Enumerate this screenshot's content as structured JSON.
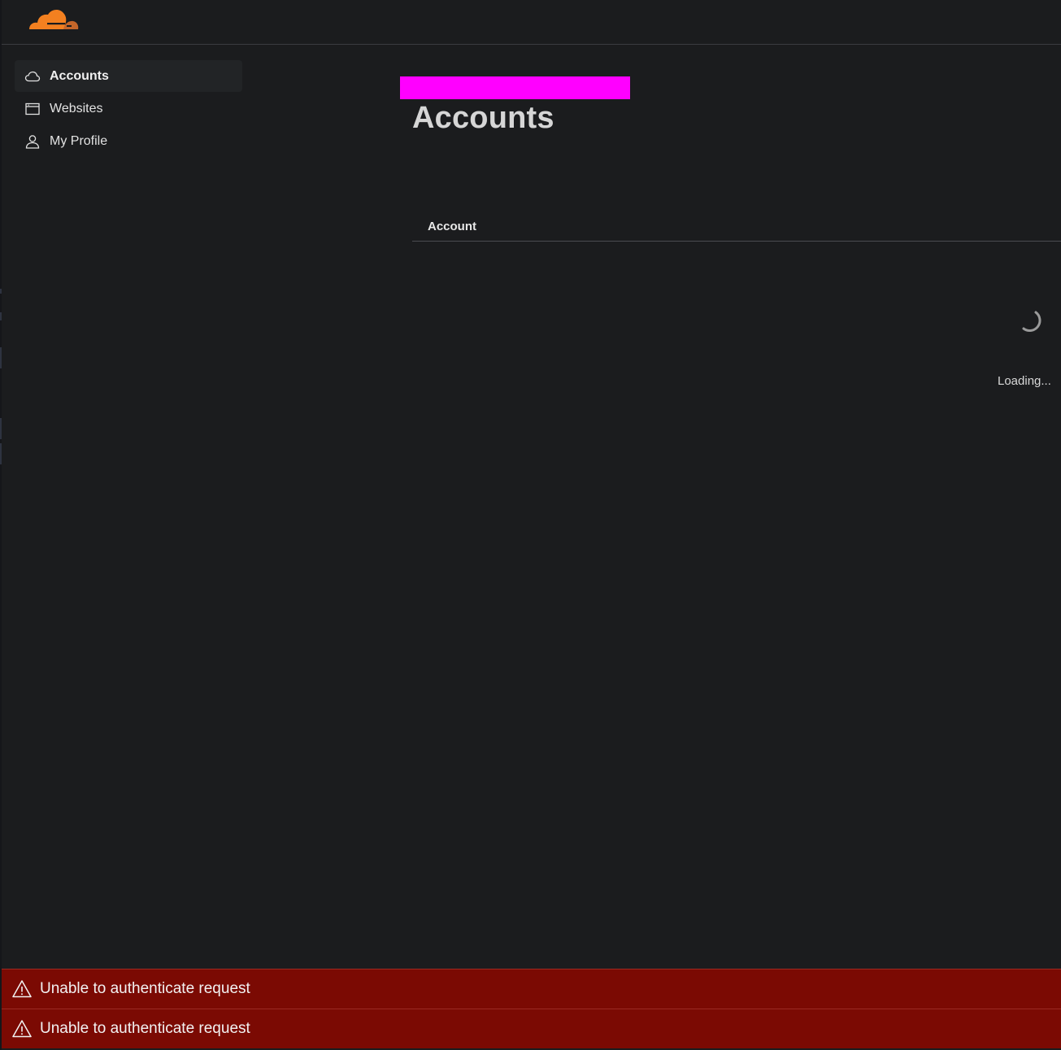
{
  "nav": {
    "items": [
      {
        "label": "Accounts",
        "icon": "cloud-icon",
        "active": true
      },
      {
        "label": "Websites",
        "icon": "browser-window-icon",
        "active": false
      },
      {
        "label": "My Profile",
        "icon": "user-icon",
        "active": false
      }
    ]
  },
  "main": {
    "title": "Accounts",
    "table": {
      "columns": [
        "Account"
      ]
    },
    "loading_text": "Loading..."
  },
  "toasts": [
    {
      "message": "Unable to authenticate request",
      "icon": "warning-triangle-icon"
    },
    {
      "message": "Unable to authenticate request",
      "icon": "warning-triangle-icon"
    }
  ],
  "colors": {
    "background": "#1b1c1e",
    "brand_orange": "#f38020",
    "brand_orange_dark": "#c5662a",
    "toast_error": "#7b0a03",
    "redaction": "#ff00ff"
  }
}
